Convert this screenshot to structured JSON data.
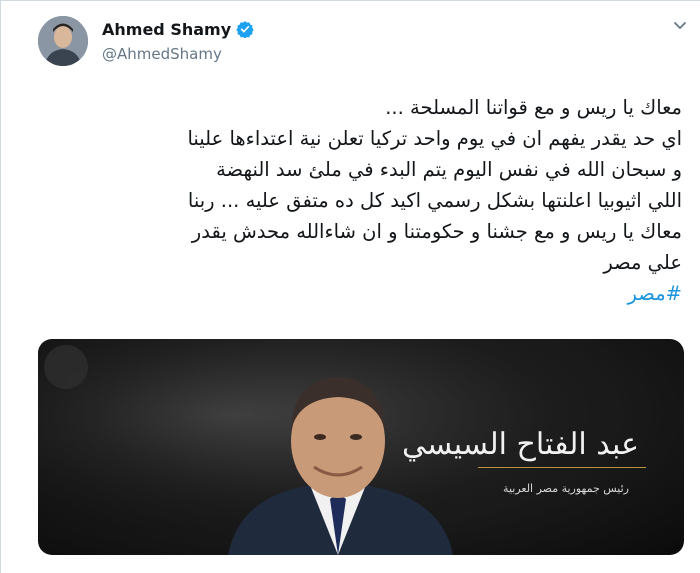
{
  "author": {
    "name": "Ahmed Shamy",
    "handle": "@AhmedShamy",
    "verified": true,
    "avatar_icon": "avatar-photo"
  },
  "tweet": {
    "lines": [
      "معاك يا ريس و مع قواتنا المسلحة ...",
      "اي حد يقدر يفهم ان في يوم واحد تركيا تعلن نية اعتداءها علينا",
      "و سبحان الله في نفس اليوم يتم البدء في ملئ سد النهضة",
      "اللي اثيوبيا اعلنتها بشكل رسمي اكيد كل ده متفق عليه ... ربنا",
      "معاك يا ريس و مع جشنا و حكومتنا و ان شاءالله محدش يقدر",
      "علي مصر"
    ],
    "hashtag": "#مصر"
  },
  "media": {
    "title": "عبد الفتاح السيسي",
    "subtitle": "رئيس جمهورية مصر العربية"
  },
  "colors": {
    "text": "#14171a",
    "secondary": "#657786",
    "link": "#1b95e0",
    "verified": "#1da1f2"
  },
  "icons": [
    "verified-badge-icon",
    "chevron-down-icon"
  ]
}
